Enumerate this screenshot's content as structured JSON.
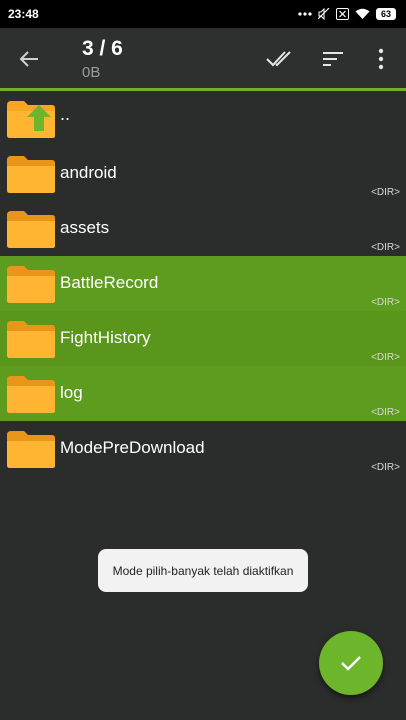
{
  "status_bar": {
    "time": "23:48",
    "icons": [
      "more-dots-icon",
      "mute-icon",
      "sim-x-icon",
      "wifi-icon"
    ],
    "battery": "63"
  },
  "toolbar": {
    "title": "3 / 6",
    "subtitle": "0B",
    "accent_color": "#6fb22a"
  },
  "files": [
    {
      "name": "..",
      "type": "parent",
      "dir_label": "",
      "selected": false
    },
    {
      "name": "android",
      "type": "folder",
      "dir_label": "<DIR>",
      "selected": false
    },
    {
      "name": "assets",
      "type": "folder",
      "dir_label": "<DIR>",
      "selected": false
    },
    {
      "name": "BattleRecord",
      "type": "folder",
      "dir_label": "<DIR>",
      "selected": true
    },
    {
      "name": "FightHistory",
      "type": "folder",
      "dir_label": "<DIR>",
      "selected": true
    },
    {
      "name": "log",
      "type": "folder",
      "dir_label": "<DIR>",
      "selected": true
    },
    {
      "name": "ModePreDownload",
      "type": "folder",
      "dir_label": "<DIR>",
      "selected": false
    }
  ],
  "toast": {
    "message": "Mode pilih-banyak telah diaktifkan"
  },
  "colors": {
    "background": "#2b2d2c",
    "selected_row": "#5e9c1f",
    "folder": "#f5a623",
    "fab": "#6db52b"
  }
}
